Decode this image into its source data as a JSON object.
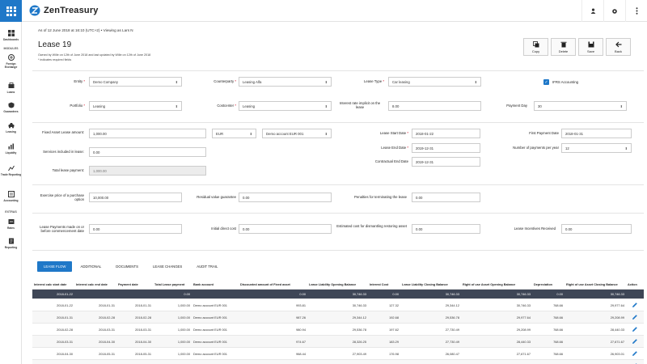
{
  "app": {
    "name": "ZenTreasury",
    "accent": "#1f78c8"
  },
  "sidebar": {
    "items": [
      {
        "label": "Dashboards",
        "icon": "dashboard-icon"
      },
      {
        "label": "Foreign Exchange",
        "icon": "fx-icon"
      },
      {
        "label": "Loans",
        "icon": "loans-icon"
      },
      {
        "label": "Guarantees",
        "icon": "guarantees-icon"
      },
      {
        "label": "Leasing",
        "icon": "leasing-icon"
      },
      {
        "label": "Liquidity",
        "icon": "liquidity-icon"
      },
      {
        "label": "Trade Reporting",
        "icon": "trade-reporting-icon"
      },
      {
        "label": "Accounting",
        "icon": "accounting-icon"
      },
      {
        "label": "Rates",
        "icon": "rates-icon"
      },
      {
        "label": "Reporting",
        "icon": "reporting-icon"
      }
    ],
    "sections": {
      "modules": "MODULES",
      "extras": "EXTRAS"
    }
  },
  "header": {
    "as_of": "As of 12 June 2018 at 16:10 (UTC+2) • Viewing as Lars N",
    "title": "Lease 19",
    "owned_by": "Owned by Wille on 12th of June 2018 and last updated by Wille on 12th of June 2018",
    "required_note": "* indicates required fields"
  },
  "actions": {
    "copy": "Copy",
    "delete": "Delete",
    "save": "Save",
    "back": "Back"
  },
  "form": {
    "entity": {
      "label": "Entity",
      "value": "Demo Company"
    },
    "counterparty": {
      "label": "Counterparty",
      "value": "Leasing Alfa"
    },
    "lease_type": {
      "label": "Lease Type",
      "value": "Car leasing"
    },
    "ifrs": {
      "label": "IFRS Accounting",
      "checked": true
    },
    "portfolio": {
      "label": "Portfolio",
      "value": "Leasing"
    },
    "costcenter": {
      "label": "Costcenter",
      "value": "Leasing"
    },
    "interest_rate": {
      "label": "Interest rate implicit on the lease",
      "value": "8.00"
    },
    "payment_day": {
      "label": "Payment Day",
      "value": "30"
    },
    "fixed_amount": {
      "label": "Fixed Asset Lease amount:",
      "value": "1,000.00"
    },
    "currency": {
      "value": "EUR"
    },
    "account": {
      "value": "Demo account EUR 001"
    },
    "start_date": {
      "label": "Lease Start Date",
      "value": "2018-01-22"
    },
    "first_payment": {
      "label": "First Payment Date",
      "value": "2018-01-31"
    },
    "end_date": {
      "label": "Lease End Date",
      "value": "2019-12-31"
    },
    "num_payments": {
      "label": "Number of payments per year",
      "value": "12"
    },
    "services": {
      "label": "Services included in lease:",
      "value": "0.00"
    },
    "contractual_end": {
      "label": "Contractual End Date",
      "value": "2019-12-31"
    },
    "total_payment": {
      "label": "Total lease payment:",
      "value": "1,000.00"
    },
    "exercise_price": {
      "label": "Exercise price of a purchase option",
      "value": "10,000.00"
    },
    "residual": {
      "label": "Residual value guarantee",
      "value": "0.00"
    },
    "penalties": {
      "label": "Penalties for terminating the lease",
      "value": "0.00"
    },
    "payments_before": {
      "label": "Lease Payments made on or before commencement date",
      "value": "0.00"
    },
    "initial_cost": {
      "label": "Initial direct cost",
      "value": "0.00"
    },
    "dismantling": {
      "label": "Estimated cost for dismantling restoring asset",
      "value": "0.00"
    },
    "incentives": {
      "label": "Lease Incentives Received",
      "value": "0.00"
    }
  },
  "tabs": [
    "LEASE FLOW",
    "ADDITIONAL",
    "DOCUMENTS",
    "LEASE CHANGES",
    "AUDIT TRAIL"
  ],
  "table": {
    "headers": [
      "Interest calc start date",
      "Interest calc end date",
      "Payment date",
      "Total Lease payment",
      "Bank account",
      "Discounted amount of Fixed asset",
      "Lease Liability Opening Balance",
      "Interest Cost",
      "Lease Liability Closing Balance",
      "Right of use Asset Opening Balance",
      "Depreciation",
      "Right of use Asset Closing Balance",
      "Action"
    ],
    "first_row": [
      "2018-01-22",
      "",
      "",
      "0.00",
      "",
      "0.00",
      "30,746.33",
      "0.00",
      "30,746.33",
      "30,746.33",
      "0.00",
      "30,746.33"
    ],
    "rows": [
      [
        "2018-01-22",
        "2018-01-31",
        "2018-01-31",
        "1,000.00",
        "Demo account EUR 001",
        "993.81",
        "30,746.33",
        "127.32",
        "29,344.12",
        "30,746.33",
        "768.66",
        "29,977.64"
      ],
      [
        "2018-01-31",
        "2018-02-28",
        "2018-02-28",
        "1,000.00",
        "Demo account EUR 001",
        "987.26",
        "29,344.12",
        "192.68",
        "29,536.78",
        "29,977.64",
        "768.66",
        "29,208.99"
      ],
      [
        "2018-02-28",
        "2018-03-31",
        "2018-03-31",
        "1,000.00",
        "Demo account EUR 001",
        "980.94",
        "29,536.78",
        "197.62",
        "27,730.49",
        "29,208.99",
        "768.66",
        "28,440.33"
      ],
      [
        "2018-03-31",
        "2018-04-30",
        "2018-04-30",
        "1,000.00",
        "Demo account EUR 001",
        "974.67",
        "28,326.25",
        "183.29",
        "27,730.49",
        "28,440.33",
        "768.66",
        "27,671.67"
      ],
      [
        "2018-04-30",
        "2018-05-31",
        "2018-05-31",
        "1,000.00",
        "Demo account EUR 001",
        "968.44",
        "27,903.49",
        "176.98",
        "26,080.47",
        "27,671.67",
        "768.66",
        "26,903.01"
      ],
      [
        "2018-05-31",
        "2018-06-30",
        "2018-06-30",
        "1,000.00",
        "Demo account EUR 001",
        "962.25",
        "26,003.47",
        "171.58",
        "25,583.36",
        "26,903.01",
        "768.66",
        "26,134.36"
      ]
    ]
  }
}
